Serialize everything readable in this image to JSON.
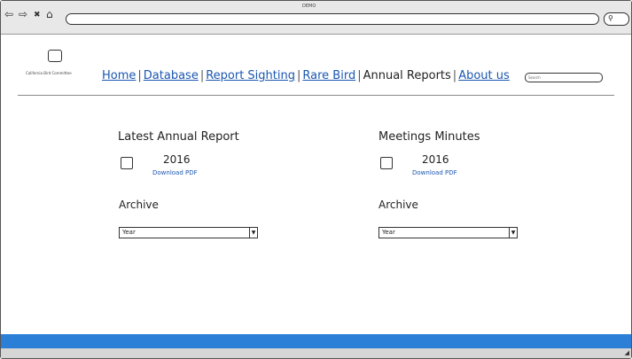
{
  "window": {
    "title": "DEMO"
  },
  "browser": {
    "back_icon": "back-arrow-icon",
    "forward_icon": "forward-arrow-icon",
    "stop_icon": "close-icon",
    "home_icon": "home-icon",
    "back_glyph": "⇦",
    "forward_glyph": "⇨",
    "stop_glyph": "✖",
    "home_glyph": "⌂",
    "search_glyph": "⚲"
  },
  "site": {
    "logo_text": "California Bird Committee"
  },
  "nav": {
    "items": [
      {
        "label": "Home"
      },
      {
        "label": "Database"
      },
      {
        "label": "Report Sighting"
      },
      {
        "label": "Rare Bird"
      },
      {
        "label": "Annual Reports",
        "active": true
      },
      {
        "label": "About us"
      }
    ],
    "separator": "|",
    "search_placeholder": "Search"
  },
  "annual_report": {
    "title": "Latest Annual Report",
    "year": "2016",
    "link": "Download PDF",
    "archive_label": "Archive",
    "select_value": "Year"
  },
  "minutes": {
    "title": "Meetings Minutes",
    "year": "2016",
    "link": "Download PDF",
    "archive_label": "Archive",
    "select_value": "Year"
  },
  "colors": {
    "link": "#1a56b0",
    "footer": "#2b7fd6"
  }
}
